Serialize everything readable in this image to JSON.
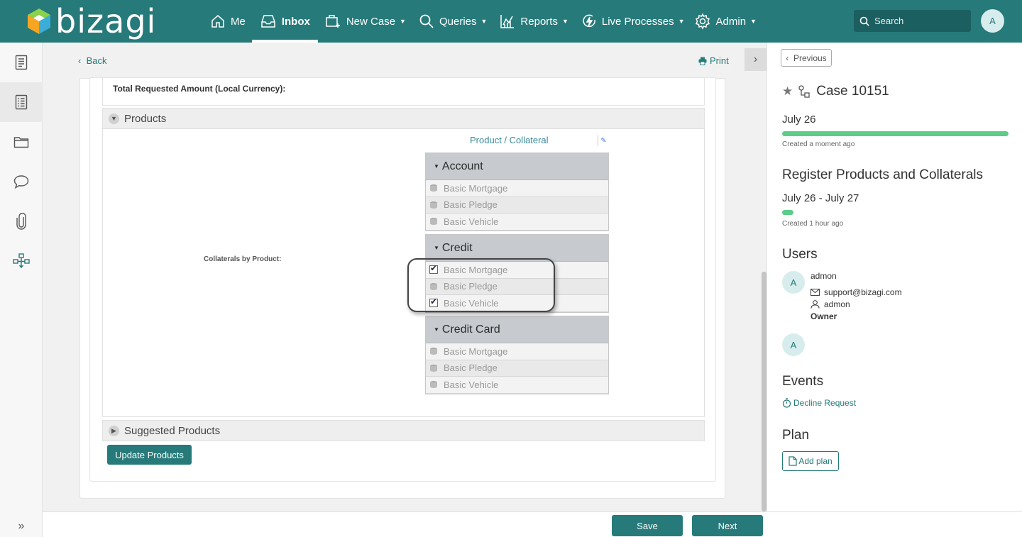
{
  "brand": {
    "name": "bizagi",
    "colors": {
      "primary": "#267a7a",
      "progress": "#5ccc88"
    }
  },
  "nav": {
    "items": [
      {
        "label": "Me",
        "icon": "home-icon"
      },
      {
        "label": "Inbox",
        "icon": "inbox-icon",
        "active": true
      },
      {
        "label": "New Case",
        "icon": "new-case-icon",
        "dropdown": true
      },
      {
        "label": "Queries",
        "icon": "search-icon",
        "dropdown": true
      },
      {
        "label": "Reports",
        "icon": "chart-icon",
        "dropdown": true
      },
      {
        "label": "Live Processes",
        "icon": "lightning-icon",
        "dropdown": true
      },
      {
        "label": "Admin",
        "icon": "gear-icon",
        "dropdown": true
      }
    ],
    "search_placeholder": "Search",
    "user_initial": "A"
  },
  "rail": {
    "items": [
      "form-icon",
      "list-icon",
      "folder-icon",
      "comment-icon",
      "paperclip-icon",
      "workflow-icon"
    ],
    "expand_glyph": "»"
  },
  "main": {
    "back_label": "Back",
    "print_label": "Print",
    "total_label": "Total Requested Amount (Local Currency):",
    "products_group": "Products",
    "suggested_group": "Suggested Products",
    "collaterals_label": "Collaterals by Product:",
    "tree_title": "Product / Collateral",
    "tree": [
      {
        "name": "Account",
        "items": [
          {
            "label": "Basic Mortgage",
            "checked": null
          },
          {
            "label": "Basic Pledge",
            "checked": null
          },
          {
            "label": "Basic Vehicle",
            "checked": null
          }
        ]
      },
      {
        "name": "Credit",
        "items": [
          {
            "label": "Basic Mortgage",
            "checked": true
          },
          {
            "label": "Basic Pledge",
            "checked": null
          },
          {
            "label": "Basic Vehicle",
            "checked": true
          }
        ]
      },
      {
        "name": "Credit Card",
        "items": [
          {
            "label": "Basic Mortgage",
            "checked": null
          },
          {
            "label": "Basic Pledge",
            "checked": null
          },
          {
            "label": "Basic Vehicle",
            "checked": null
          }
        ]
      }
    ],
    "update_button": "Update Products"
  },
  "footer": {
    "save": "Save",
    "next": "Next"
  },
  "panel": {
    "previous": "Previous",
    "case_title": "Case 10151",
    "case_date": "July 26",
    "case_created": "Created a moment ago",
    "activity_title": "Register Products and Collaterals",
    "activity_dates": "July 26 - July 27",
    "activity_created": "Created 1 hour ago",
    "users_heading": "Users",
    "users": [
      {
        "initial": "A",
        "name": "admon",
        "email": "support@bizagi.com",
        "username": "admon",
        "role": "Owner"
      },
      {
        "initial": "A"
      }
    ],
    "events_heading": "Events",
    "event_link": "Decline Request",
    "plan_heading": "Plan",
    "add_plan": "Add plan"
  }
}
